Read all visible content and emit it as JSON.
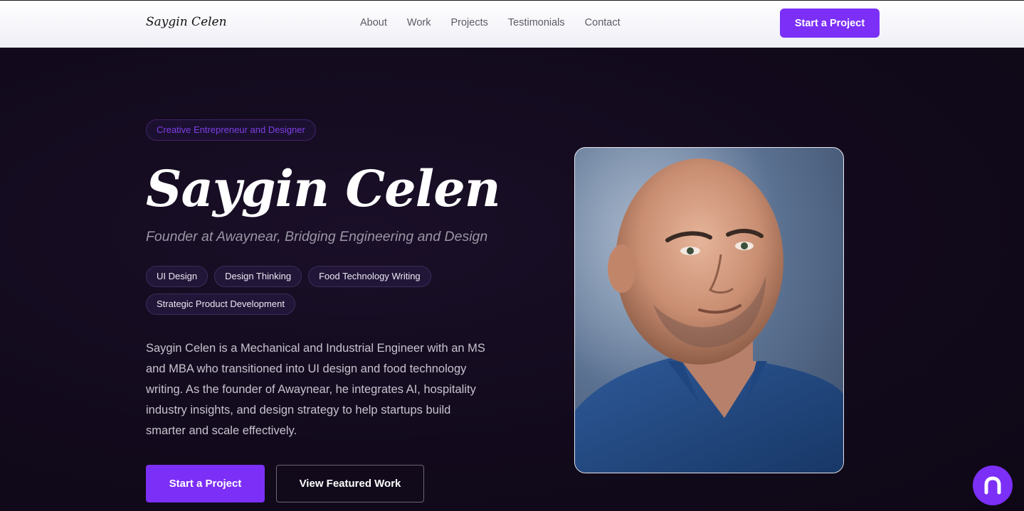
{
  "header": {
    "logo": "Saygin Celen",
    "nav": [
      "About",
      "Work",
      "Projects",
      "Testimonials",
      "Contact"
    ],
    "cta": "Start a Project"
  },
  "hero": {
    "eyebrow": "Creative Entrepreneur and Designer",
    "name": "Saygin Celen",
    "subtitle": "Founder at Awaynear, Bridging Engineering and Design",
    "tags": [
      "UI Design",
      "Design Thinking",
      "Food Technology Writing",
      "Strategic Product Development"
    ],
    "bio": "Saygin Celen is a Mechanical and Industrial Engineer with an MS and MBA who transitioned into UI design and food technology writing. As the founder of Awaynear, he integrates AI, hospitality industry insights, and design strategy to help startups build smarter and scale effectively.",
    "primary_cta": "Start a Project",
    "secondary_cta": "View Featured Work"
  },
  "colors": {
    "accent": "#7b2ff7",
    "background": "#120a1c"
  },
  "icons": {
    "chat": "chat-bubble-icon"
  }
}
